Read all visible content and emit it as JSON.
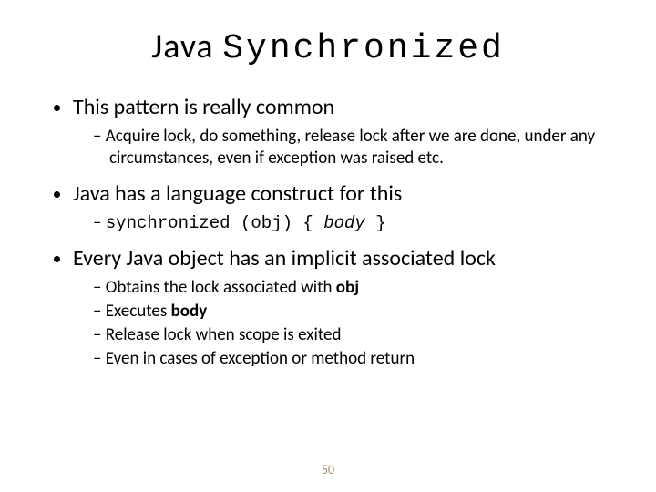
{
  "title_plain": "Java ",
  "title_mono": "Synchronized",
  "bullets": {
    "b1": "This pattern is really common",
    "b1_sub1": "Acquire lock, do something, release lock after we are done, under any circumstances,  even if exception was raised etc.",
    "b2": "Java has a language construct for this",
    "b2_code_kw": "synchronized (obj) { ",
    "b2_code_body": "body",
    "b2_code_end": " }",
    "b3": "Every Java object has an implicit associated lock",
    "b3_sub1_a": "Obtains the lock associated with ",
    "b3_sub1_b": "obj",
    "b3_sub2_a": "Executes ",
    "b3_sub2_b": "body",
    "b3_sub3": "Release lock when scope is exited",
    "b3_sub4": "Even in cases of exception or method return"
  },
  "page_number": "50"
}
